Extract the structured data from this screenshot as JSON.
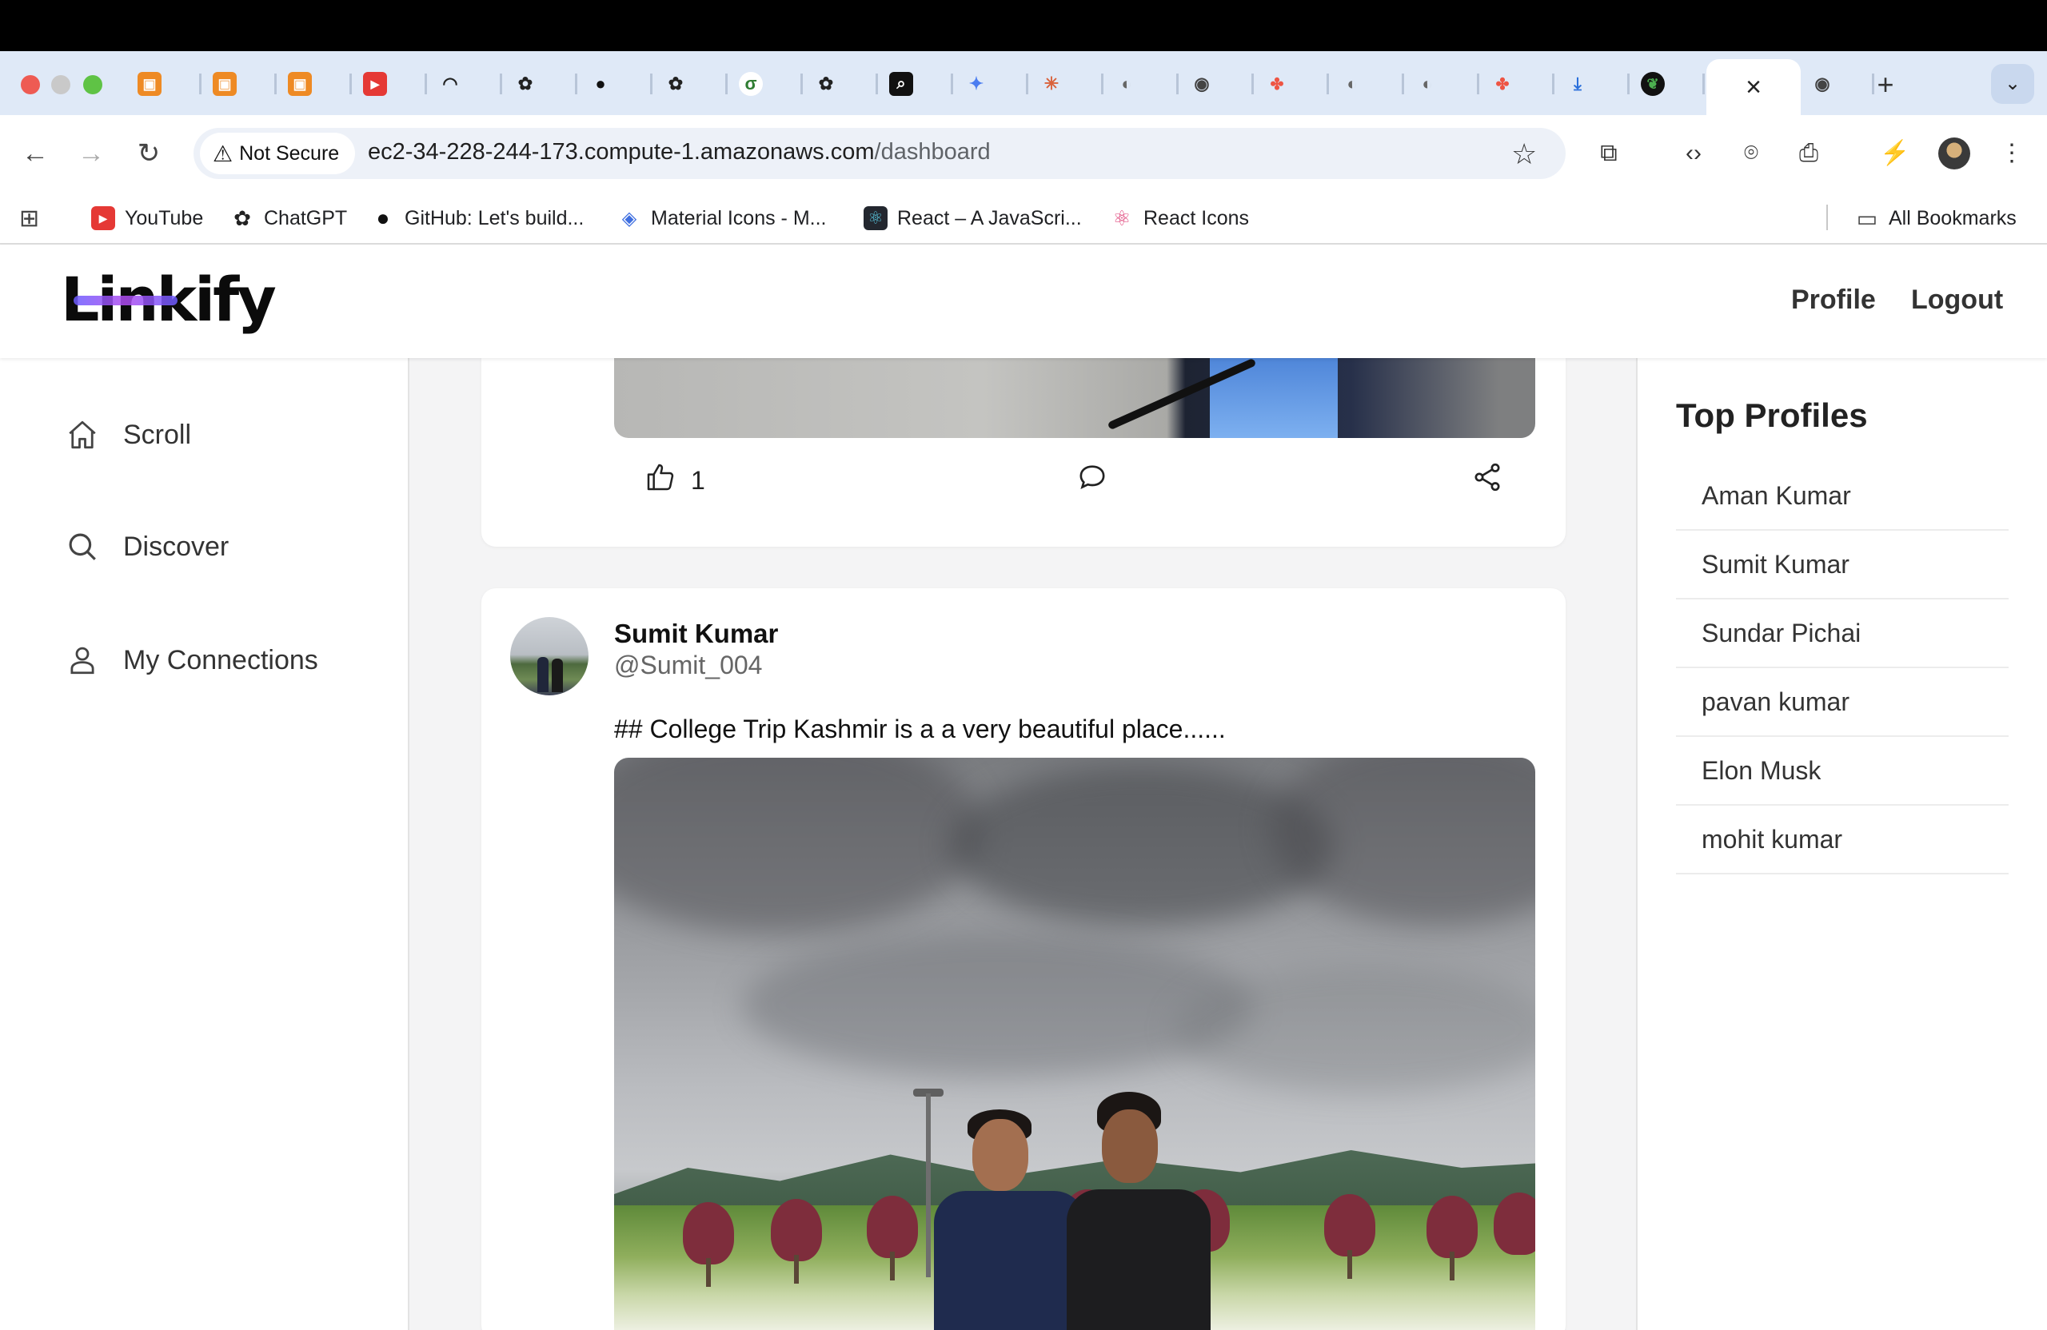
{
  "browser": {
    "tabs_count": 23,
    "active_tab_close": "×",
    "new_tab": "+",
    "address": {
      "security_label": "Not Secure",
      "host": "ec2-34-228-244-173.compute-1.amazonaws.com",
      "path": "/dashboard"
    },
    "bookmarks": [
      {
        "label": "YouTube",
        "icon": "youtube-icon"
      },
      {
        "label": "ChatGPT",
        "icon": "chatgpt-icon"
      },
      {
        "label": "GitHub: Let's build...",
        "icon": "github-icon"
      },
      {
        "label": "Material Icons - M...",
        "icon": "material-icons-icon"
      },
      {
        "label": "React – A JavaScri...",
        "icon": "react-icon"
      },
      {
        "label": "React Icons",
        "icon": "react-icons-icon"
      }
    ],
    "all_bookmarks": "All Bookmarks"
  },
  "app": {
    "logo": "Linkify",
    "nav": {
      "profile": "Profile",
      "logout": "Logout"
    },
    "sidebar": [
      {
        "label": "Scroll",
        "icon": "home-icon"
      },
      {
        "label": "Discover",
        "icon": "search-icon"
      },
      {
        "label": "My Connections",
        "icon": "user-icon"
      }
    ],
    "top_profiles": {
      "title": "Top Profiles",
      "items": [
        "Aman Kumar",
        "Sumit Kumar",
        "Sundar Pichai",
        "pavan kumar",
        "Elon Musk",
        "mohit kumar"
      ]
    },
    "posts": [
      {
        "likes": "1"
      },
      {
        "author": "Sumit Kumar",
        "handle": "@Sumit_004",
        "text": "## College Trip Kashmir is a a very beautiful place......"
      }
    ],
    "colors": {
      "accent": "#6b5cff",
      "page_bg": "#f4f4f5",
      "text": "#333333"
    }
  }
}
